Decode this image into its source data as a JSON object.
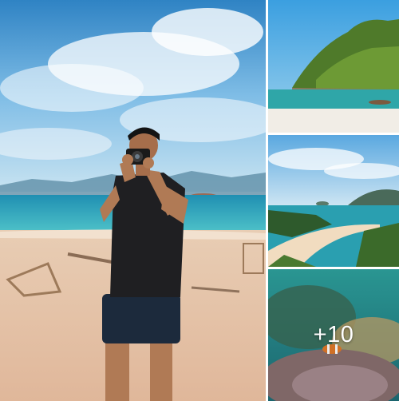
{
  "gallery": {
    "more_count": "+10"
  },
  "photos": [
    {
      "subject": "man-with-camera-on-beach-photo"
    },
    {
      "subject": "island-with-forest-photo"
    },
    {
      "subject": "beach-bay-aerial-photo"
    },
    {
      "subject": "underwater-coral-clownfish-photo"
    }
  ],
  "colors": {
    "sky": "#6fb0e0",
    "sea": "#2f9fb3",
    "sand": "#e9c9aa",
    "overlay_text": "#ffffff"
  }
}
